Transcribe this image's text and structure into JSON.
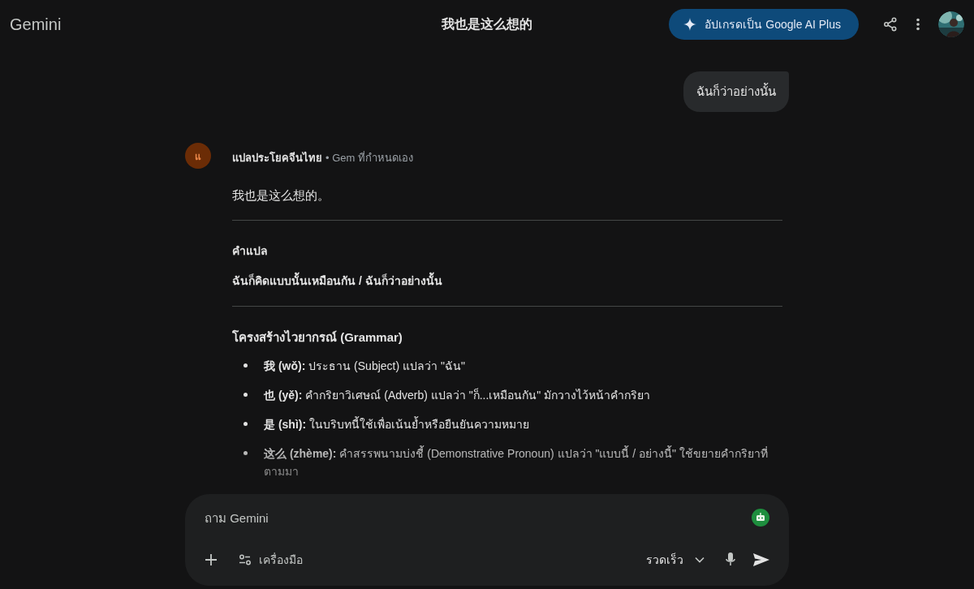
{
  "header": {
    "brand": "Gemini",
    "title": "我也是这么想的",
    "upgrade_button": "อัปเกรดเป็น Google AI Plus"
  },
  "user_message": "ฉันก็ว่าอย่างนั้น",
  "response": {
    "avatar_letter": "แ",
    "gem_name": "แปลประโยคจีนไทย",
    "gem_note": "• Gem ที่กำหนดเอง",
    "sentence": "我也是这么想的。",
    "translation_heading": "คำแปล",
    "translation": "ฉันก็คิดแบบนั้นเหมือนกัน / ฉันก็ว่าอย่างนั้น",
    "grammar_heading": "โครงสร้างไวยากรณ์ (Grammar)",
    "grammar_items": [
      "**我 (wǒ):** ประธาน (Subject) แปลว่า \"ฉัน\"",
      "**也 (yě):** คำกริยาวิเศษณ์ (Adverb) แปลว่า \"ก็...เหมือนกัน\" มักวางไว้หน้าคำกริยา",
      "**是 (shì):** ในบริบทนี้ใช้เพื่อเน้นย้ำหรือยืนยันความหมาย",
      "**这么 (zhème):** คำสรรพนามบ่งชี้ (Demonstrative Pronoun) แปลว่า \"แบบนี้ / อย่างนี้\" ใช้ขยายคำกริยาที่ตามมา"
    ]
  },
  "composer": {
    "placeholder": "ถาม Gemini",
    "tools_button": "เครื่องมือ",
    "mode_button": "รวดเร็ว"
  }
}
